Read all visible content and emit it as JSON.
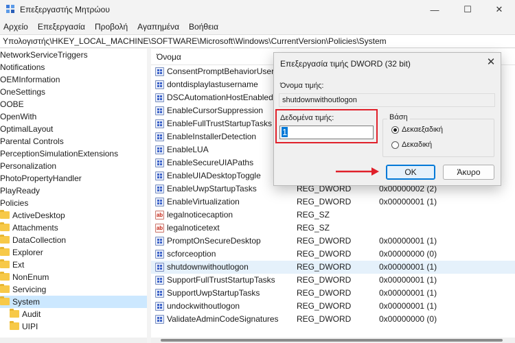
{
  "window": {
    "title": "Επεξεργαστής Μητρώου",
    "min": "—",
    "max": "☐",
    "close": "✕"
  },
  "menu": [
    "Αρχείο",
    "Επεξεργασία",
    "Προβολή",
    "Αγαπημένα",
    "Βοήθεια"
  ],
  "address": "Υπολογιστής\\HKEY_LOCAL_MACHINE\\SOFTWARE\\Microsoft\\Windows\\CurrentVersion\\Policies\\System",
  "tree": [
    {
      "label": "NetworkServiceTriggers",
      "folder": false,
      "indent": 0
    },
    {
      "label": "Notifications",
      "folder": false,
      "indent": 0
    },
    {
      "label": "OEMInformation",
      "folder": false,
      "indent": 0
    },
    {
      "label": "OneSettings",
      "folder": false,
      "indent": 0
    },
    {
      "label": "OOBE",
      "folder": false,
      "indent": 0
    },
    {
      "label": "OpenWith",
      "folder": false,
      "indent": 0
    },
    {
      "label": "OptimalLayout",
      "folder": false,
      "indent": 0
    },
    {
      "label": "Parental Controls",
      "folder": false,
      "indent": 0
    },
    {
      "label": "PerceptionSimulationExtensions",
      "folder": false,
      "indent": 0
    },
    {
      "label": "Personalization",
      "folder": false,
      "indent": 0
    },
    {
      "label": "PhotoPropertyHandler",
      "folder": false,
      "indent": 0
    },
    {
      "label": "PlayReady",
      "folder": false,
      "indent": 0
    },
    {
      "label": "Policies",
      "folder": false,
      "indent": 0
    },
    {
      "label": "ActiveDesktop",
      "folder": true,
      "indent": 0
    },
    {
      "label": "Attachments",
      "folder": true,
      "indent": 0
    },
    {
      "label": "DataCollection",
      "folder": true,
      "indent": 0
    },
    {
      "label": "Explorer",
      "folder": true,
      "indent": 0
    },
    {
      "label": "Ext",
      "folder": true,
      "indent": 0
    },
    {
      "label": "NonEnum",
      "folder": true,
      "indent": 0
    },
    {
      "label": "Servicing",
      "folder": true,
      "indent": 0
    },
    {
      "label": "System",
      "folder": true,
      "indent": 0,
      "selected": true
    },
    {
      "label": "Audit",
      "folder": true,
      "indent": 1
    },
    {
      "label": "UIPI",
      "folder": true,
      "indent": 1
    }
  ],
  "list": {
    "col_name": "Όνομα",
    "rows": [
      {
        "name": "ConsentPromptBehaviorUser",
        "type": "",
        "data": "",
        "icon": "dword"
      },
      {
        "name": "dontdisplaylastusername",
        "type": "",
        "data": "",
        "icon": "dword"
      },
      {
        "name": "DSCAutomationHostEnabled",
        "type": "",
        "data": "",
        "icon": "dword"
      },
      {
        "name": "EnableCursorSuppression",
        "type": "",
        "data": "",
        "icon": "dword"
      },
      {
        "name": "EnableFullTrustStartupTasks",
        "type": "",
        "data": "",
        "icon": "dword"
      },
      {
        "name": "EnableInstallerDetection",
        "type": "",
        "data": "",
        "icon": "dword"
      },
      {
        "name": "EnableLUA",
        "type": "",
        "data": "",
        "icon": "dword"
      },
      {
        "name": "EnableSecureUIAPaths",
        "type": "",
        "data": "",
        "icon": "dword"
      },
      {
        "name": "EnableUIADesktopToggle",
        "type": "",
        "data": "",
        "icon": "dword"
      },
      {
        "name": "EnableUwpStartupTasks",
        "type": "REG_DWORD",
        "data": "0x00000002 (2)",
        "icon": "dword"
      },
      {
        "name": "EnableVirtualization",
        "type": "REG_DWORD",
        "data": "0x00000001 (1)",
        "icon": "dword"
      },
      {
        "name": "legalnoticecaption",
        "type": "REG_SZ",
        "data": "",
        "icon": "sz"
      },
      {
        "name": "legalnoticetext",
        "type": "REG_SZ",
        "data": "",
        "icon": "sz"
      },
      {
        "name": "PromptOnSecureDesktop",
        "type": "REG_DWORD",
        "data": "0x00000001 (1)",
        "icon": "dword"
      },
      {
        "name": "scforceoption",
        "type": "REG_DWORD",
        "data": "0x00000000 (0)",
        "icon": "dword"
      },
      {
        "name": "shutdownwithoutlogon",
        "type": "REG_DWORD",
        "data": "0x00000001 (1)",
        "icon": "dword",
        "highlight": true
      },
      {
        "name": "SupportFullTrustStartupTasks",
        "type": "REG_DWORD",
        "data": "0x00000001 (1)",
        "icon": "dword"
      },
      {
        "name": "SupportUwpStartupTasks",
        "type": "REG_DWORD",
        "data": "0x00000001 (1)",
        "icon": "dword"
      },
      {
        "name": "undockwithoutlogon",
        "type": "REG_DWORD",
        "data": "0x00000001 (1)",
        "icon": "dword"
      },
      {
        "name": "ValidateAdminCodeSignatures",
        "type": "REG_DWORD",
        "data": "0x00000000 (0)",
        "icon": "dword"
      }
    ]
  },
  "dialog": {
    "title": "Επεξεργασία τιμής DWORD (32 bit)",
    "close": "✕",
    "value_name_label": "Όνομα τιμής:",
    "value_name": "shutdownwithoutlogon",
    "value_data_label": "Δεδομένα τιμής:",
    "value_data": "1",
    "base_label": "Βάση",
    "hex_label": "Δεκαεξαδική",
    "dec_label": "Δεκαδική",
    "base_selected": "hex",
    "ok_label": "OK",
    "cancel_label": "Άκυρο",
    "accent_red": "#e0202a"
  }
}
